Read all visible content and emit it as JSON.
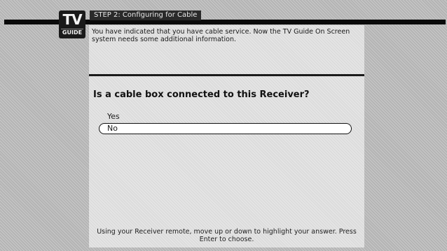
{
  "logo": {
    "main": "TV",
    "sub": "GUIDE"
  },
  "header": {
    "step_title": "STEP 2: Configuring for Cable"
  },
  "intro_text": "You have indicated that you have cable service. Now the TV Guide On Screen system needs some additional information.",
  "question": "Is a cable box connected to this Receiver?",
  "options": [
    {
      "label": "Yes",
      "selected": false
    },
    {
      "label": "No",
      "selected": true
    }
  ],
  "help_text": "Using your Receiver remote, move up or down to highlight your answer. Press Enter to choose."
}
